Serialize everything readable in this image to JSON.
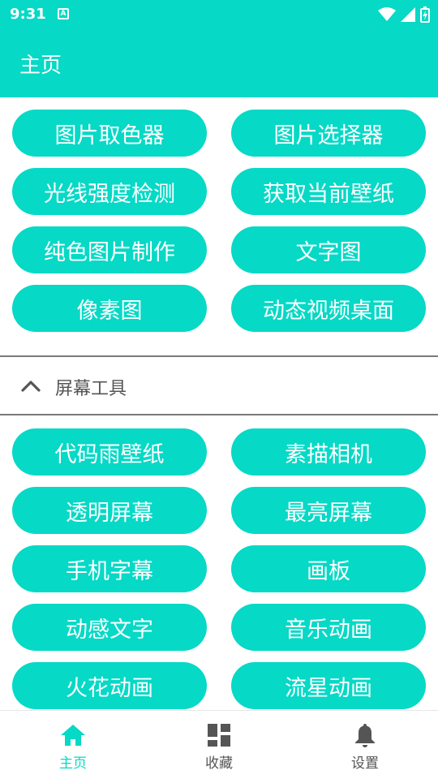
{
  "status_bar": {
    "time": "9:31",
    "notification_glyph": "A"
  },
  "app_bar": {
    "title": "主页"
  },
  "tools_top": [
    "图片取色器",
    "图片选择器",
    "光线强度检测",
    "获取当前壁纸",
    "纯色图片制作",
    "文字图",
    "像素图",
    "动态视频桌面"
  ],
  "section": {
    "title": "屏幕工具",
    "icon": "chevron-up-icon"
  },
  "tools_screen": [
    "代码雨壁纸",
    "素描相机",
    "透明屏幕",
    "最亮屏幕",
    "手机字幕",
    "画板",
    "动感文字",
    "音乐动画",
    "火花动画",
    "流星动画"
  ],
  "bottom_nav": [
    {
      "label": "主页",
      "icon": "home-icon",
      "active": true
    },
    {
      "label": "收藏",
      "icon": "dashboard-icon",
      "active": false
    },
    {
      "label": "设置",
      "icon": "bell-icon",
      "active": false
    }
  ],
  "colors": {
    "accent": "#06d9c6",
    "nav_inactive": "#555555",
    "divider": "#7a7a7a"
  }
}
